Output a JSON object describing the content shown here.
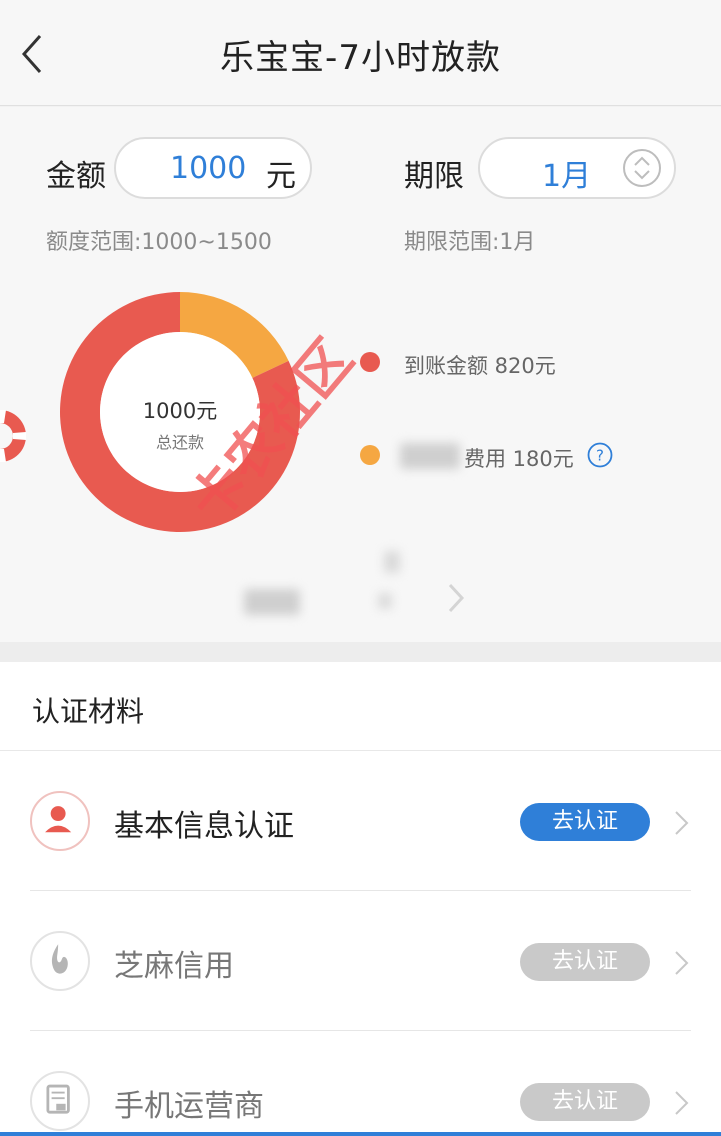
{
  "header": {
    "title": "乐宝宝-7小时放款"
  },
  "loan": {
    "amount_label": "金额",
    "amount_value": "1000",
    "amount_unit": "元",
    "term_label": "期限",
    "term_value": "1月",
    "amount_range": "额度范围:1000~1500",
    "term_range": "期限范围:1月",
    "donut": {
      "center_amount": "1000元",
      "center_label": "总还款"
    },
    "legend": [
      {
        "text": "到账金额 820元",
        "color": "#e85a50"
      },
      {
        "text": "费用 180元",
        "color": "#f5a742"
      }
    ]
  },
  "chart_data": {
    "type": "pie",
    "categories": [
      "到账金额",
      "费用"
    ],
    "values": [
      820,
      180
    ],
    "colors": [
      "#e85a50",
      "#f5a742"
    ]
  },
  "watermark": "卡农社区",
  "verify": {
    "title": "认证材料",
    "rows": [
      {
        "label": "基本信息认证",
        "button": "去认证",
        "active": true,
        "icon": "user-icon"
      },
      {
        "label": "芝麻信用",
        "button": "去认证",
        "active": false,
        "icon": "sesame-icon"
      },
      {
        "label": "手机运营商",
        "button": "去认证",
        "active": false,
        "icon": "phone-card-icon"
      }
    ]
  },
  "colors": {
    "accent": "#2f7fd8",
    "disabled": "#c9c9c9",
    "red": "#e85a50",
    "orange": "#f5a742"
  }
}
